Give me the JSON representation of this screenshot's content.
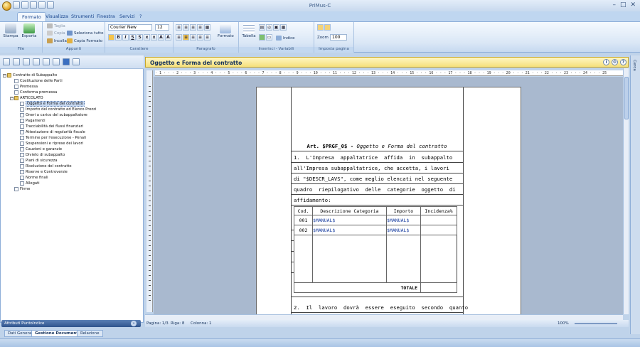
{
  "app": {
    "title": "PriMus-C"
  },
  "menu_tabs": [
    "Formato",
    "Visualizza",
    "Strumenti",
    "Finestra",
    "Servizi",
    "?"
  ],
  "ribbon": {
    "file": {
      "label": "File",
      "stampa": "Stampa",
      "esporta": "Esporta"
    },
    "appunti": {
      "label": "Appunti",
      "taglia": "Taglia",
      "copia": "Copia",
      "incolla": "Incolla",
      "seleziona_tutto": "Seleziona tutto",
      "copia_formato": "Copia Formato"
    },
    "carattere": {
      "label": "Carattere",
      "font": "Courier New",
      "size": "12"
    },
    "paragrafo": {
      "label": "Paragrafo",
      "formato": "Formato"
    },
    "inserisci": {
      "label": "Inserisci - Variabili",
      "tabella": "Tabella",
      "indice": "Indice"
    },
    "imposta": {
      "label": "Imposta pagina",
      "zoom_label": "Zoom",
      "zoom_value": "100"
    }
  },
  "tree": {
    "root": "Contratto di Subappalto",
    "top_items": [
      "Costituzione delle Parti",
      "Premessa",
      "Conferma premessa"
    ],
    "folder": "ARTICOLATO",
    "articles": [
      "Oggetto e Forma del contratto",
      "Importo del contratto ed Elenco Prezzi",
      "Oneri a carico del subappaltatore",
      "Pagamenti",
      "Tracciabilità dei flussi finanziari",
      "Attestazione di regolarità fiscale",
      "Termine per l'esecuzione - Penali",
      "Sospensioni e riprese dei lavori",
      "Cauzioni e garanzie",
      "Divieto di subappalto",
      "Piani di sicurezza",
      "Risoluzione del contratto",
      "Riserve e Controversie",
      "Norme finali",
      "Allegati"
    ],
    "last": "Firme",
    "selected_index": 0
  },
  "attr_panel": {
    "title": "Attributi PuntoIndice"
  },
  "bottom_tabs": [
    "Dati Generali",
    "Gestione Documento",
    "Relazione"
  ],
  "doc": {
    "header": "Oggetto e Forma del contratto",
    "heading_prefix": "Art. $PRGF_0$ - ",
    "heading_italic": "Oggetto e Forma del contratto",
    "lines": [
      "1.  L'Impresa  appaltatrice  affida  in  subappalto",
      "all'Impresa subappaltatrice, che accetta, i lavori",
      "di \"$DESCR_LAVS\", come meglio elencati nel seguente",
      "quadro  riepilogativo  delle  categorie  oggetto  di",
      "affidamento:"
    ],
    "table": {
      "headers": [
        "Cod.",
        "Descrizione Categoria",
        "Importo",
        "Incidenza%"
      ],
      "rows": [
        [
          "001",
          "$MANUAL$",
          "$MANUAL$",
          ""
        ],
        [
          "002",
          "$MANUAL$",
          "$MANUAL$",
          ""
        ]
      ],
      "total": "TOTALE"
    },
    "line2": "2.  Il  lavoro  dovrà  essere  eseguito  secondo  quanto"
  },
  "ruler": "· 1 · · · 2 · · · 3 · · · 4 · · · 5 · · · 6 · · · 7 · · · 8 · · · 9 · · · 10 · · · 11 · · · 12 · · · 13 · · · 14 · · · 15 · · · 16 · · · 17 · · · 18 · · · 19 · · · 20 · · · 21 · · · 22 · · · 23 · · · 24 · · · 25",
  "status": {
    "pagina": "Pagina: 1/3",
    "riga": "Riga: 8",
    "colonna": "Colonna: 1",
    "zoom": "100%"
  },
  "right_strip": "Cerca",
  "colors": {
    "accent": "#15428b",
    "header_bg": "#f5df7a",
    "link_text": "#1a3fa0"
  }
}
